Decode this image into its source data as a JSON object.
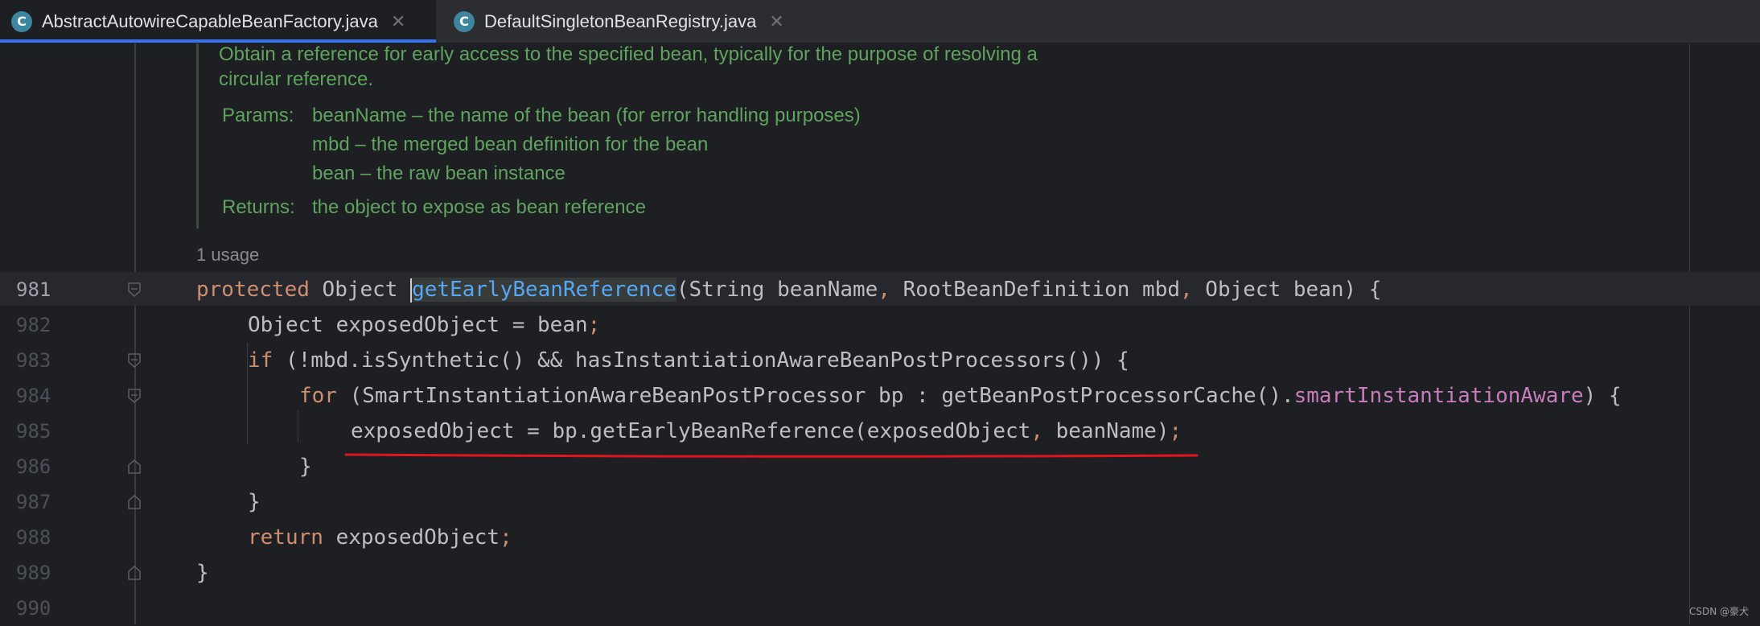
{
  "tabs": [
    {
      "label": "AbstractAutowireCapableBeanFactory.java",
      "icon": "class-icon",
      "active": true
    },
    {
      "label": "DefaultSingletonBeanRegistry.java",
      "icon": "class-icon",
      "active": false
    }
  ],
  "doc": {
    "summary_line1": "Obtain a reference for early access to the specified bean, typically for the purpose of resolving a",
    "summary_line2": "circular reference.",
    "params_label": "Params:",
    "params": [
      {
        "name": "beanName",
        "desc": " – the name of the bean (for error handling purposes)"
      },
      {
        "name": "mbd",
        "desc": " – the merged bean definition for the bean"
      },
      {
        "name": "bean",
        "desc": " – the raw bean instance"
      }
    ],
    "returns_label": "Returns:",
    "returns_text": "the object to expose as bean reference"
  },
  "usage_hint": "1 usage",
  "lines": [
    {
      "num": "981"
    },
    {
      "num": "982"
    },
    {
      "num": "983"
    },
    {
      "num": "984"
    },
    {
      "num": "985"
    },
    {
      "num": "986"
    },
    {
      "num": "987"
    },
    {
      "num": "988"
    },
    {
      "num": "989"
    },
    {
      "num": "990"
    }
  ],
  "code": {
    "l981": {
      "kw": "protected",
      "type": " Object ",
      "method": "getEarlyBeanReference",
      "rest": "(String beanName",
      "c1": ",",
      "p2": " RootBeanDefinition mbd",
      "c2": ",",
      "p3": " Object bean) {"
    },
    "l982": {
      "text": "Object exposedObject = bean",
      "semi": ";"
    },
    "l983": {
      "kw": "if",
      "text": " (!mbd.isSynthetic() && hasInstantiationAwareBeanPostProcessors()) {"
    },
    "l984": {
      "kw": "for",
      "text": " (SmartInstantiationAwareBeanPostProcessor bp : getBeanPostProcessorCache().",
      "field": "smartInstantiationAware",
      "end": ") {"
    },
    "l985": {
      "text": "exposedObject = bp.getEarlyBeanReference(exposedObject",
      "c": ",",
      "text2": " beanName)",
      "semi": ";"
    },
    "l986": {
      "text": "}"
    },
    "l987": {
      "text": "}"
    },
    "l988": {
      "kw": "return",
      "text": " exposedObject",
      "semi": ";"
    },
    "l989": {
      "text": "}"
    }
  },
  "watermark": "CSDN @豪犬",
  "colors": {
    "keyword": "#cf8e6d",
    "doc": "#5fa35f",
    "field": "#c77dbb",
    "underline": "#e0161f",
    "accent": "#3574f0"
  }
}
